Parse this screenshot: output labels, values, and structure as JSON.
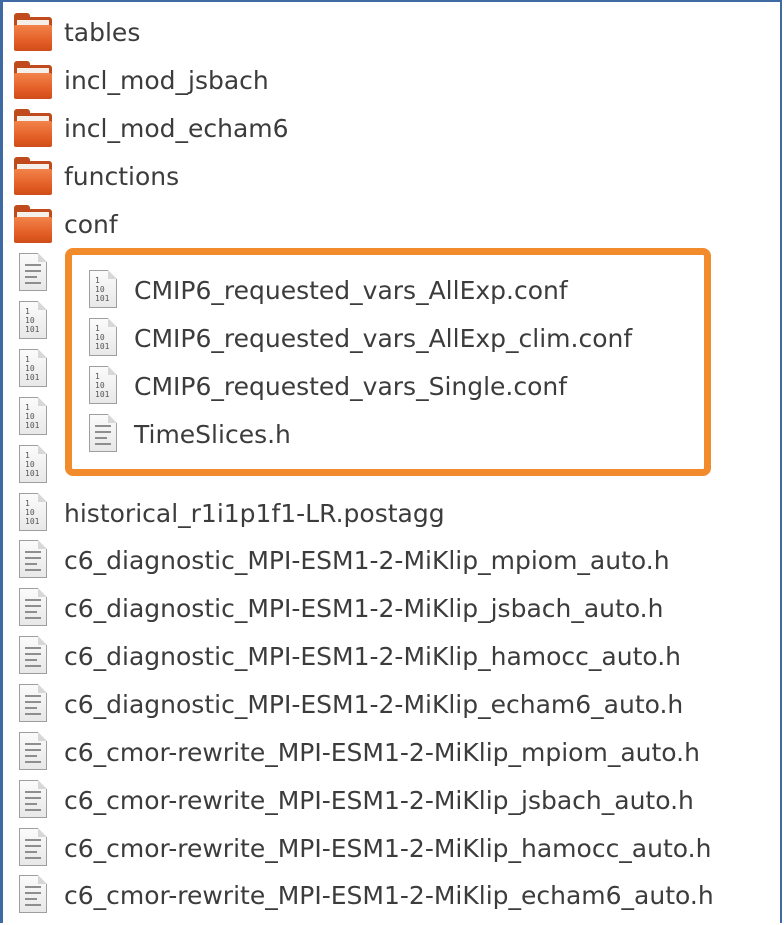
{
  "file_list": {
    "items": [
      {
        "name": "tables",
        "type": "folder"
      },
      {
        "name": "incl_mod_jsbach",
        "type": "folder"
      },
      {
        "name": "incl_mod_echam6",
        "type": "folder"
      },
      {
        "name": "functions",
        "type": "folder"
      },
      {
        "name": "conf",
        "type": "folder"
      },
      {
        "name": "historical_r1i1p1f1-LR.postagg",
        "type": "binary-file"
      },
      {
        "name": "c6_diagnostic_MPI-ESM1-2-MiKlip_mpiom_auto.h",
        "type": "text-file"
      },
      {
        "name": "c6_diagnostic_MPI-ESM1-2-MiKlip_jsbach_auto.h",
        "type": "text-file"
      },
      {
        "name": "c6_diagnostic_MPI-ESM1-2-MiKlip_hamocc_auto.h",
        "type": "text-file"
      },
      {
        "name": "c6_diagnostic_MPI-ESM1-2-MiKlip_echam6_auto.h",
        "type": "text-file"
      },
      {
        "name": "c6_cmor-rewrite_MPI-ESM1-2-MiKlip_mpiom_auto.h",
        "type": "text-file"
      },
      {
        "name": "c6_cmor-rewrite_MPI-ESM1-2-MiKlip_jsbach_auto.h",
        "type": "text-file"
      },
      {
        "name": "c6_cmor-rewrite_MPI-ESM1-2-MiKlip_hamocc_auto.h",
        "type": "text-file"
      },
      {
        "name": "c6_cmor-rewrite_MPI-ESM1-2-MiKlip_echam6_auto.h",
        "type": "text-file"
      }
    ],
    "highlighted_items": [
      {
        "name": "CMIP6_requested_vars_AllExp.conf",
        "type": "binary-file"
      },
      {
        "name": "CMIP6_requested_vars_AllExp_clim.conf",
        "type": "binary-file"
      },
      {
        "name": "CMIP6_requested_vars_Single.conf",
        "type": "binary-file"
      },
      {
        "name": "TimeSlices.h",
        "type": "text-file"
      }
    ]
  },
  "colors": {
    "highlight_border": "#f28b2c",
    "folder": "#e05a22",
    "frame": "#3f6aa3"
  }
}
